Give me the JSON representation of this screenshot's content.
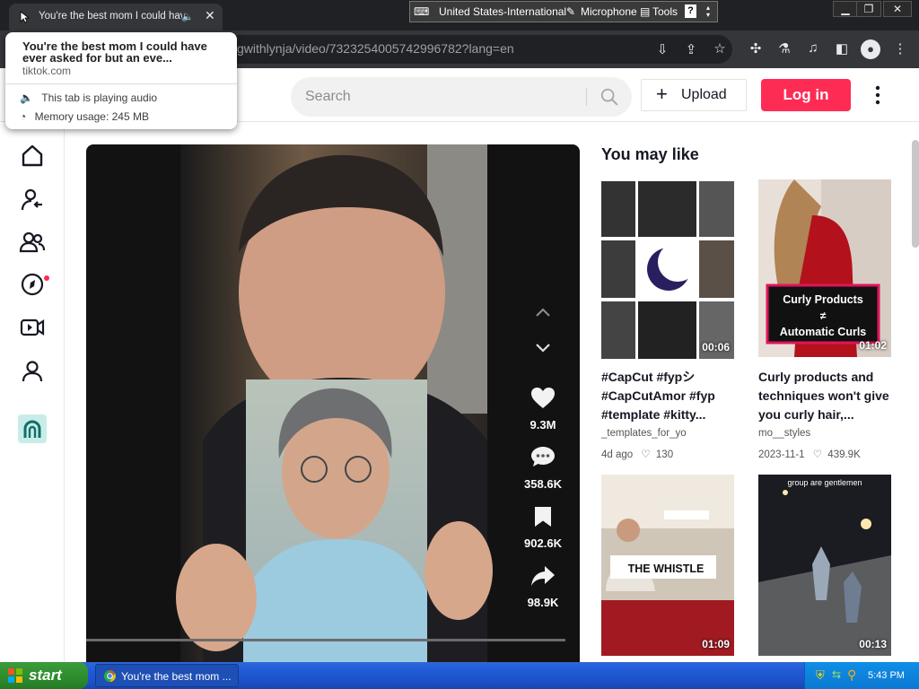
{
  "browser": {
    "tab_title": "You're the best mom I could have ever asked for but an eve...",
    "url_visible": "gwithlynja/video/7323254005742996782?lang=en",
    "hover_card": {
      "title": "You're the best mom I could have ever asked for but an eve...",
      "domain": "tiktok.com",
      "audio_status": "This tab is playing audio",
      "memory_usage": "Memory usage: 245 MB"
    }
  },
  "language_bar": {
    "language": "United States-International",
    "microphone": "Microphone",
    "tools": "Tools",
    "help": "?"
  },
  "header": {
    "search_placeholder": "Search",
    "upload_label": "Upload",
    "login_label": "Log in"
  },
  "video": {
    "stats": {
      "likes": "9.3M",
      "comments": "358.6K",
      "bookmarks": "902.6K",
      "shares": "98.9K"
    }
  },
  "you_may_like": {
    "heading": "You may like",
    "cards": [
      {
        "duration": "00:06",
        "title": "#CapCut #fypシ #CapCutAmor #fyp #template #kitty...",
        "author": "_templates_for_yo",
        "date": "4d ago",
        "likes": "130",
        "overlay": ""
      },
      {
        "duration": "01:02",
        "title": "Curly products and techniques won't give you curly hair,...",
        "author": "mo__styles",
        "date": "2023-11-1",
        "likes": "439.9K",
        "overlay": "Curly Products ≠ Automatic Curls"
      },
      {
        "duration": "01:09",
        "title": "",
        "author": "",
        "date": "",
        "likes": "",
        "overlay": "THE WHISTLE"
      },
      {
        "duration": "00:13",
        "title": "",
        "author": "",
        "date": "",
        "likes": "",
        "overlay": "group are gentlemen"
      }
    ]
  },
  "taskbar": {
    "start_label": "start",
    "task_label": "You're the best mom ...",
    "time": "5:43 PM"
  },
  "colors": {
    "brand": "#fe2c55",
    "taskbar": "#245edb",
    "start": "#2f8f2f"
  }
}
